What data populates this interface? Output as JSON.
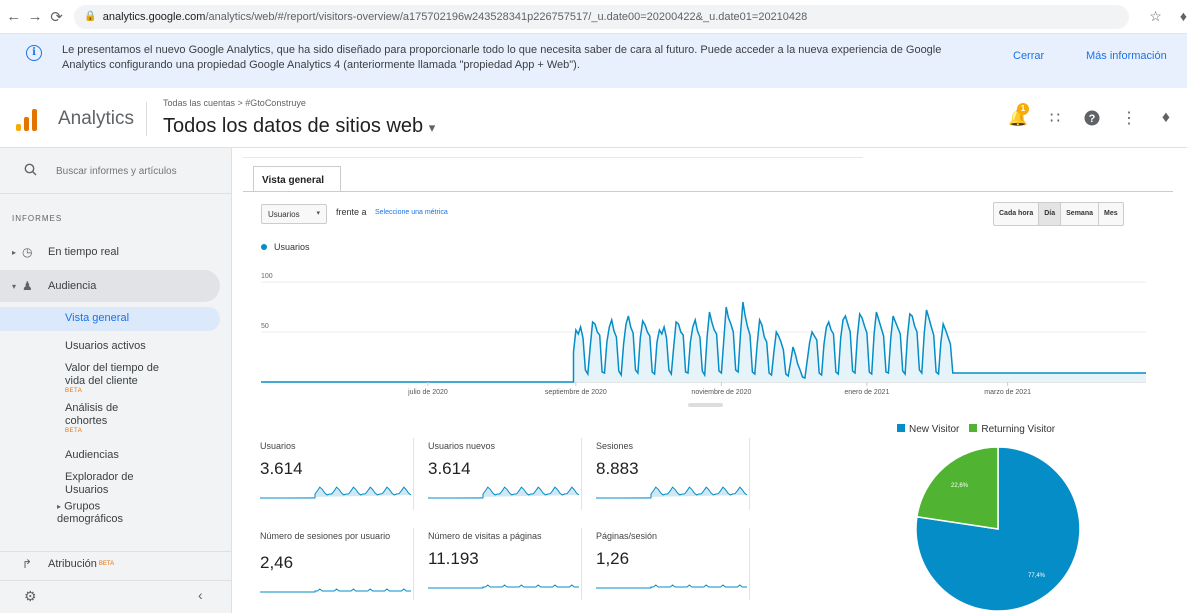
{
  "browser": {
    "url_host": "analytics.google.com",
    "url_path": "/analytics/web/#/report/visitors-overview/a175702196w243528341p226757517/_u.date00=20200422&_u.date01=20210428",
    "back_icon": "arrow-left-icon",
    "forward_icon": "arrow-right-icon",
    "reload_icon": "reload-icon",
    "star_icon": "star-icon",
    "extension_icon": "extension-icon"
  },
  "notice": {
    "text": "Le presentamos el nuevo Google Analytics, que ha sido diseñado para proporcionarle todo lo que necesita saber de cara al futuro. Puede acceder a la nueva experiencia de Google Analytics configurando una propiedad Google Analytics 4 (anteriormente llamada \"propiedad App + Web\").",
    "close_label": "Cerrar",
    "more_label": "Más información"
  },
  "header": {
    "product": "Analytics",
    "account_path": "Todas las cuentas > #GtoConstruye",
    "property": "Todos los datos de sitios web",
    "notification_count": "1",
    "logo_colors": [
      "#f9ab00",
      "#e37400",
      "#e37400"
    ]
  },
  "sidebar": {
    "search_placeholder": "Buscar informes y artículos",
    "section": "INFORMES",
    "items": [
      {
        "label": "En tiempo real",
        "icon": "clock-icon"
      },
      {
        "label": "Audiencia",
        "icon": "person-icon"
      },
      {
        "label": "Atribución",
        "icon": "attribution-icon",
        "badge": "BETA"
      }
    ],
    "sub_items": [
      {
        "label": "Vista general"
      },
      {
        "label": "Usuarios activos"
      },
      {
        "label": "Valor del tiempo de vida del cliente",
        "badge": "BETA"
      },
      {
        "label": "Análisis de cohortes",
        "badge": "BETA"
      },
      {
        "label": "Audiencias"
      },
      {
        "label": "Explorador de Usuarios"
      },
      {
        "label": "Grupos demográficos"
      }
    ]
  },
  "report": {
    "tab": "Vista general",
    "metric": "Usuarios",
    "vs": "frente a",
    "select_metric": "Seleccione una métrica",
    "periods": [
      "Cada hora",
      "Día",
      "Semana",
      "Mes"
    ],
    "active_period": "Día"
  },
  "chart_data": [
    {
      "type": "area",
      "legend": "Usuarios",
      "y_ticks": [
        "100",
        "50"
      ],
      "ylim": [
        0,
        100
      ],
      "x_ticks": [
        "julio de 2020",
        "septiembre de 2020",
        "noviembre de 2020",
        "enero de 2021",
        "marzo de 2021"
      ],
      "x_range": [
        "2020-04-22",
        "2021-04-28"
      ],
      "series": [
        {
          "name": "Usuarios",
          "color": "#058dc7",
          "weekly_pattern_note": "zero until 2020-08-31, then daily values oscillating roughly 5-70 with weekly cycle",
          "x_start": "2020-08-31",
          "values": [
            30,
            52,
            48,
            55,
            44,
            12,
            8,
            35,
            60,
            58,
            50,
            47,
            10,
            9,
            40,
            55,
            62,
            51,
            45,
            11,
            7,
            38,
            58,
            66,
            55,
            49,
            12,
            9,
            44,
            61,
            57,
            50,
            46,
            10,
            8,
            40,
            52,
            48,
            55,
            44,
            12,
            8,
            35,
            60,
            58,
            50,
            47,
            10,
            9,
            40,
            55,
            62,
            51,
            45,
            11,
            7,
            45,
            70,
            60,
            52,
            48,
            11,
            9,
            42,
            75,
            64,
            58,
            50,
            12,
            10,
            48,
            80,
            66,
            55,
            47,
            10,
            8,
            38,
            62,
            57,
            45,
            40,
            9,
            7,
            30,
            50,
            46,
            40,
            32,
            8,
            6,
            20,
            35,
            28,
            18,
            12,
            5,
            4,
            22,
            40,
            50,
            46,
            42,
            9,
            7,
            38,
            55,
            60,
            52,
            48,
            10,
            8,
            44,
            62,
            66,
            58,
            50,
            11,
            9,
            46,
            68,
            64,
            56,
            49,
            10,
            8,
            48,
            70,
            62,
            54,
            46,
            10,
            9,
            44,
            66,
            60,
            54,
            48,
            11,
            8,
            46,
            68,
            66,
            56,
            50,
            12,
            9,
            48,
            72,
            64,
            55,
            47,
            10,
            8,
            40,
            58,
            52,
            45,
            38,
            9
          ]
        }
      ]
    },
    {
      "type": "pie",
      "labels": [
        "New Visitor",
        "Returning Visitor"
      ],
      "values": [
        77.4,
        22.6
      ],
      "slice_labels": [
        "77,4%",
        "22,6%"
      ],
      "colors": [
        "#058dc7",
        "#50b432"
      ]
    }
  ],
  "scorecards": [
    {
      "label": "Usuarios",
      "value": "3.614"
    },
    {
      "label": "Usuarios nuevos",
      "value": "3.614"
    },
    {
      "label": "Sesiones",
      "value": "8.883"
    },
    {
      "label": "Número de sesiones por usuario",
      "value": "2,46"
    },
    {
      "label": "Número de visitas a páginas",
      "value": "11.193"
    },
    {
      "label": "Páginas/sesión",
      "value": "1,26"
    }
  ]
}
